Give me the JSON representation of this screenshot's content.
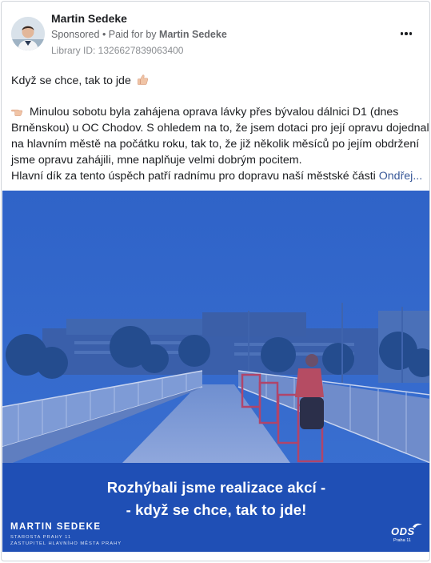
{
  "post": {
    "author": "Martin Sedeke",
    "sponsored": "Sponsored",
    "separator": " • ",
    "paid_prefix": "Paid for by ",
    "paid_by": "Martin Sedeke",
    "library_id": "Library ID: 1326627839063400",
    "more_icon": "more-options-icon"
  },
  "body": {
    "line1": "Když se chce, tak to jde",
    "line1_emoji": "thumbs-up-icon",
    "para_emoji": "pointing-hand-icon",
    "para_lines": [
      "Minulou sobotu byla zahájena oprava lávky přes bývalou dálnici D1 (dnes",
      "Brněnskou) u OC Chodov. S ohledem na to, že jsem dotaci pro její opravu dojednal",
      "na hlavním městě na počátku roku, tak to, že již několik měsíců po jejím obdržení",
      "jsme opravu zahájili, mne naplňuje velmi dobrým pocitem.",
      "Hlavní dík za tento úspěch patří radnímu pro dopravu naší městské části "
    ],
    "see_more": "Ondřej..."
  },
  "banner": {
    "headline_1": "Rozhýbali jsme realizace akcí -",
    "headline_2": "- když se chce, tak to jde!",
    "name": "MARTIN SEDEKE",
    "role_1": "STAROSTA PRAHY 11",
    "role_2": "ZASTUPITEL HLAVNÍHO MĚSTA PRAHY",
    "logo": "ODS",
    "logo_sub": "Praha 11",
    "tint_color": "#2d62c4",
    "band_color": "#1f4fb5"
  }
}
